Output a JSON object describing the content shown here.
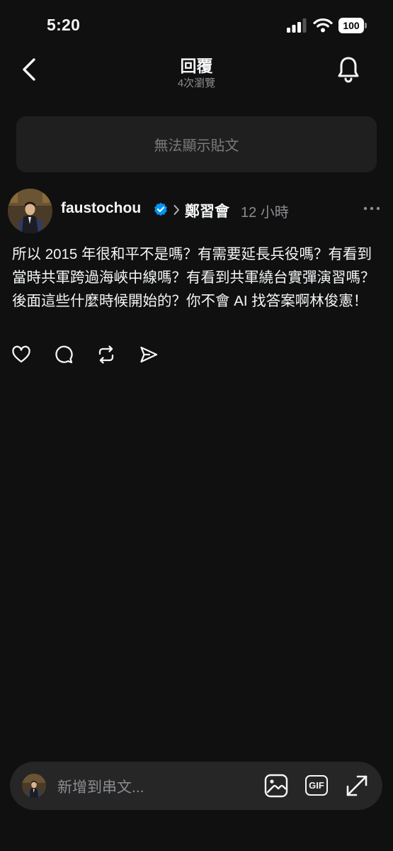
{
  "status_bar": {
    "time": "5:20",
    "battery": "100"
  },
  "header": {
    "title": "回覆",
    "views": "4次瀏覽"
  },
  "unavailable_post": {
    "text": "無法顯示貼文"
  },
  "post": {
    "username": "faustochou",
    "topic": "鄭習會",
    "time": "12 小時",
    "text": "所以 2015 年很和平不是嗎？有需要延長兵役嗎？有看到當時共軍跨過海峽中線嗎？有看到共軍繞台實彈演習嗎？後面這些什麼時候開始的？你不會 AI 找答案啊林俊憲！",
    "actions": [
      "heart-icon",
      "comment-icon",
      "repost-icon",
      "share-icon"
    ]
  },
  "composer": {
    "placeholder": "新增到串文...",
    "gif_label": "GIF"
  },
  "colors": {
    "background": "#101010",
    "verified": "#0095f6",
    "secondary_text": "#8a8d91"
  }
}
